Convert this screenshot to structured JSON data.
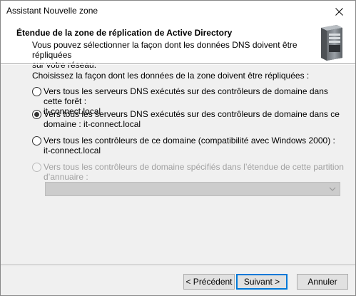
{
  "window": {
    "title": "Assistant Nouvelle zone"
  },
  "header": {
    "title": "Étendue de la zone de réplication de Active Directory",
    "description_line1": "Vous pouvez sélectionner la façon dont les données DNS doivent être répliquées",
    "description_line2": "sur votre réseau.",
    "icon": "server-icon"
  },
  "prompt": "Choisissez la façon dont les données de la zone doivent être répliquées :",
  "options": [
    {
      "line1": "Vers tous les serveurs DNS exécutés sur des contrôleurs de domaine dans cette forêt :",
      "line2": "it-connect.local",
      "checked": false,
      "enabled": true
    },
    {
      "line1": "Vers tous les serveurs DNS exécutés sur des contrôleurs de domaine dans ce",
      "line2": "domaine : it-connect.local",
      "checked": true,
      "enabled": true
    },
    {
      "line1": "Vers tous les contrôleurs de ce domaine (compatibilité avec Windows 2000) :",
      "line2": "it-connect.local",
      "checked": false,
      "enabled": true
    },
    {
      "line1": "Vers tous les contrôleurs de domaine spécifiés dans l’étendue de cette partition",
      "line2": "d’annuaire :",
      "checked": false,
      "enabled": false
    }
  ],
  "partition_select": {
    "value": "",
    "enabled": false
  },
  "buttons": {
    "back": "< Précédent",
    "next": "Suivant >",
    "cancel": "Annuler"
  },
  "colors": {
    "accent": "#0078d7",
    "disabled_text": "#a0a0a0"
  }
}
